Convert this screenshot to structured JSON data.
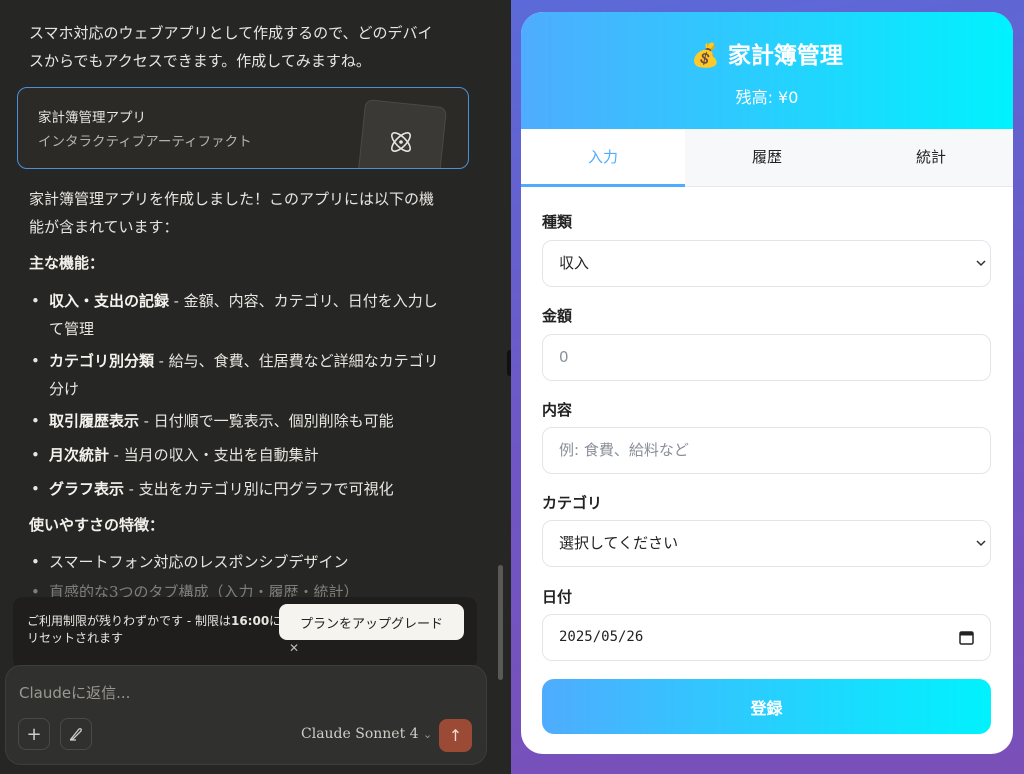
{
  "chat": {
    "intro": "スマホ対応のウェブアプリとして作成するので、どのデバイスからでもアクセスできます。作成してみますね。",
    "artifact": {
      "title": "家計簿管理アプリ",
      "subtitle": "インタラクティブアーティファクト",
      "icon": "atom-icon"
    },
    "summary": "家計簿管理アプリを作成しました！このアプリには以下の機能が含まれています：",
    "features_heading": "主な機能：",
    "features": [
      {
        "bold": "収入・支出の記録",
        "text": " - 金額、内容、カテゴリ、日付を入力して管理"
      },
      {
        "bold": "カテゴリ別分類",
        "text": " - 給与、食費、住居費など詳細なカテゴリ分け"
      },
      {
        "bold": "取引履歴表示",
        "text": " - 日付順で一覧表示、個別削除も可能"
      },
      {
        "bold": "月次統計",
        "text": " - 当月の収入・支出を自動集計"
      },
      {
        "bold": "グラフ表示",
        "text": " - 支出をカテゴリ別に円グラフで可視化"
      }
    ],
    "usability_heading": "使いやすさの特徴：",
    "usability": [
      "スマートフォン対応のレスポンシブデザイン",
      "直感的な3つのタブ構成（入力・履歴・統計）"
    ]
  },
  "limit_banner": {
    "text_prefix": "ご利用制限が残りわずかです - 制限は",
    "time": "16:00",
    "text_suffix": "にリセットされます",
    "upgrade_label": "プランをアップグレード",
    "close": "✕"
  },
  "composer": {
    "placeholder": "Claudeに返信...",
    "add_icon": "+",
    "model": "Claude Sonnet 4",
    "model_chevron": "⌄",
    "send_icon": "↑"
  },
  "app": {
    "title": "💰 家計簿管理",
    "balance": "残高: ¥0",
    "tabs": [
      {
        "label": "入力",
        "active": true
      },
      {
        "label": "履歴",
        "active": false
      },
      {
        "label": "統計",
        "active": false
      }
    ],
    "form": {
      "type_label": "種類",
      "type_value": "収入",
      "amount_label": "金額",
      "amount_placeholder": "0",
      "content_label": "内容",
      "content_placeholder": "例: 食費、給料など",
      "category_label": "カテゴリ",
      "category_value": "選択してください",
      "date_label": "日付",
      "date_value": "2025/05/26",
      "submit_label": "登録"
    },
    "accent": "#4facfe",
    "accent2": "#00f2fe"
  }
}
